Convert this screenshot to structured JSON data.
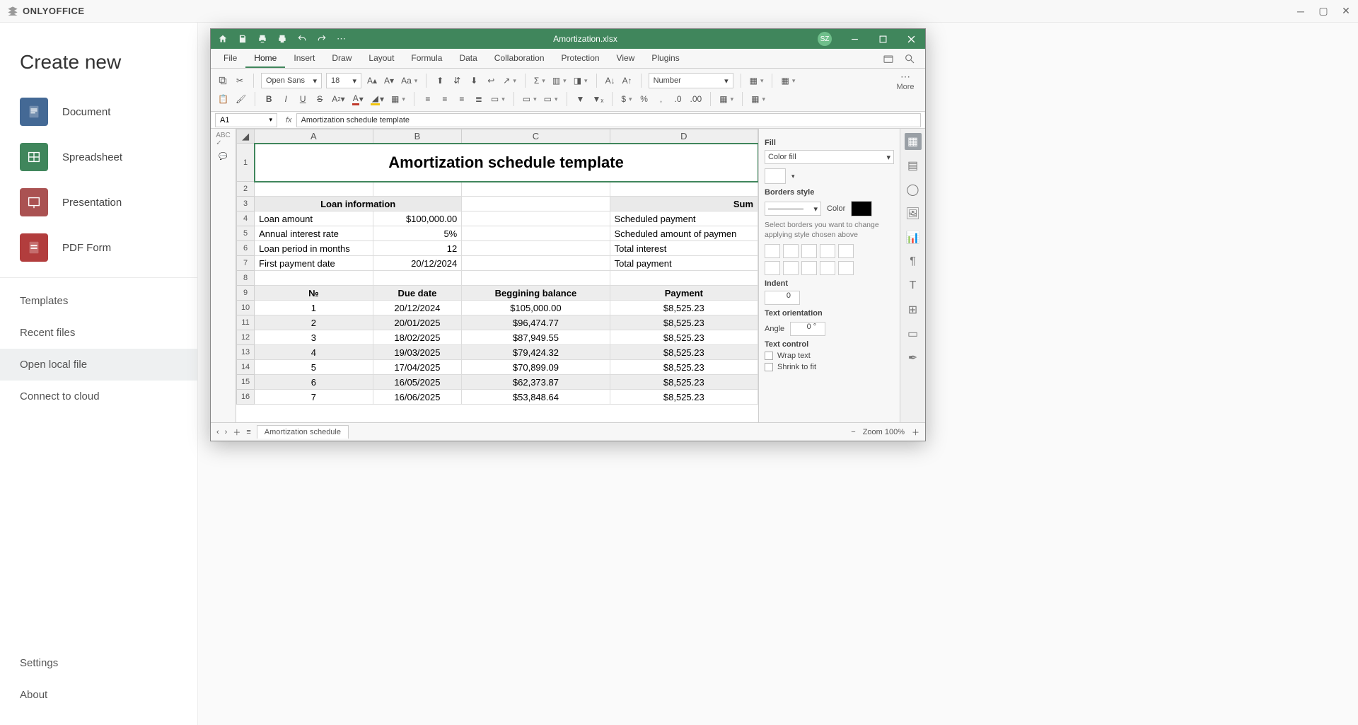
{
  "launcher": {
    "brand": "ONLYOFFICE",
    "heading": "Create new",
    "items": [
      {
        "label": "Document"
      },
      {
        "label": "Spreadsheet"
      },
      {
        "label": "Presentation"
      },
      {
        "label": "PDF Form"
      }
    ],
    "nav": [
      "Templates",
      "Recent files",
      "Open local file",
      "Connect to cloud"
    ],
    "nav_selected_index": 2,
    "bottom": [
      "Settings",
      "About"
    ]
  },
  "editor": {
    "title": "Amortization.xlsx",
    "avatar": "SZ",
    "menus": [
      "File",
      "Home",
      "Insert",
      "Draw",
      "Layout",
      "Formula",
      "Data",
      "Collaboration",
      "Protection",
      "View",
      "Plugins"
    ],
    "active_menu": 1,
    "font_name": "Open Sans",
    "font_size": "18",
    "number_format": "Number",
    "more": "More",
    "cell_ref": "A1",
    "formula_value": "Amortization schedule template",
    "columns": [
      "A",
      "B",
      "C",
      "D"
    ],
    "sheet_tab": "Amortization schedule",
    "zoom": "Zoom 100%",
    "right_panel": {
      "fill_label": "Fill",
      "fill_mode": "Color fill",
      "borders_label": "Borders style",
      "color_label": "Color",
      "borders_hint": "Select borders you want to change applying style chosen above",
      "indent_label": "Indent",
      "indent_value": "0",
      "orient_label": "Text orientation",
      "angle_label": "Angle",
      "angle_value": "0 °",
      "text_control": "Text control",
      "wrap": "Wrap text",
      "shrink": "Shrink to fit"
    },
    "content": {
      "title": "Amortization schedule template",
      "loan_info": "Loan information",
      "loan_rows": [
        {
          "l": "Loan amount",
          "v": "$100,000.00"
        },
        {
          "l": "Annual interest rate",
          "v": "5%"
        },
        {
          "l": "Loan period in months",
          "v": "12"
        },
        {
          "l": "First payment date",
          "v": "20/12/2024"
        }
      ],
      "summary": "Sum",
      "summary_rows": [
        "Scheduled payment",
        "Scheduled amount of paymen",
        "Total interest",
        "Total payment"
      ],
      "col_headers": [
        "№",
        "Due date",
        "Beggining balance",
        "Payment"
      ],
      "rows": [
        {
          "n": "1",
          "d": "20/12/2024",
          "b": "$105,000.00",
          "p": "$8,525.23"
        },
        {
          "n": "2",
          "d": "20/01/2025",
          "b": "$96,474.77",
          "p": "$8,525.23"
        },
        {
          "n": "3",
          "d": "18/02/2025",
          "b": "$87,949.55",
          "p": "$8,525.23"
        },
        {
          "n": "4",
          "d": "19/03/2025",
          "b": "$79,424.32",
          "p": "$8,525.23"
        },
        {
          "n": "5",
          "d": "17/04/2025",
          "b": "$70,899.09",
          "p": "$8,525.23"
        },
        {
          "n": "6",
          "d": "16/05/2025",
          "b": "$62,373.87",
          "p": "$8,525.23"
        },
        {
          "n": "7",
          "d": "16/06/2025",
          "b": "$53,848.64",
          "p": "$8,525.23"
        }
      ]
    }
  }
}
